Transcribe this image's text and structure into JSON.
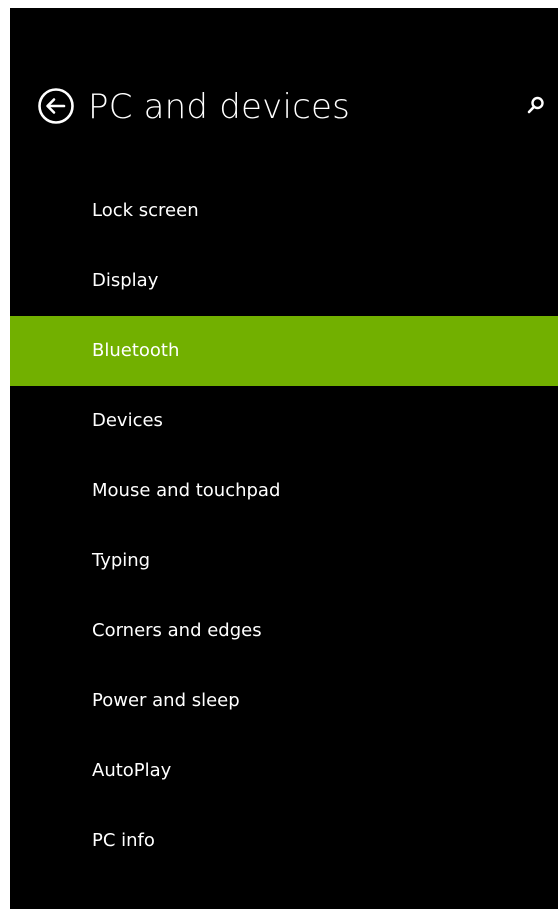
{
  "header": {
    "title": "PC and devices",
    "back_icon": "back-arrow-circle-icon",
    "search_icon": "search-icon"
  },
  "colors": {
    "background": "#000000",
    "accent": "#72b000",
    "text": "#ffffff"
  },
  "menu": {
    "selected_index": 2,
    "items": [
      {
        "label": "Lock screen"
      },
      {
        "label": "Display"
      },
      {
        "label": "Bluetooth"
      },
      {
        "label": "Devices"
      },
      {
        "label": "Mouse and touchpad"
      },
      {
        "label": "Typing"
      },
      {
        "label": "Corners and edges"
      },
      {
        "label": "Power and sleep"
      },
      {
        "label": "AutoPlay"
      },
      {
        "label": "PC info"
      }
    ]
  }
}
